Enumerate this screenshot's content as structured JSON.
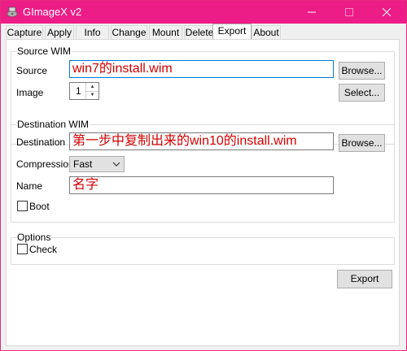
{
  "window": {
    "title": "GImageX v2"
  },
  "tabs": [
    {
      "label": "Capture"
    },
    {
      "label": "Apply"
    },
    {
      "label": "Info"
    },
    {
      "label": "Change"
    },
    {
      "label": "Mount"
    },
    {
      "label": "Delete"
    },
    {
      "label": "Export",
      "active": true
    },
    {
      "label": "About"
    }
  ],
  "source_wim": {
    "group_label": "Source WIM",
    "source_label": "Source",
    "source_value": "win7的install.wim",
    "browse_label": "Browse...",
    "image_label": "Image",
    "image_value": "1",
    "select_label": "Select..."
  },
  "destination_wim": {
    "group_label": "Destination WIM",
    "destination_label": "Destination",
    "destination_value": "第一步中复制出来的win10的install.wim",
    "browse_label": "Browse...",
    "compression_label": "Compression",
    "compression_value": "Fast",
    "name_label": "Name",
    "name_value": "名字",
    "boot_label": "Boot"
  },
  "options": {
    "group_label": "Options",
    "check_label": "Check"
  },
  "export_label": "Export",
  "colors": {
    "titlebar": "#ec1d87",
    "annotation_text": "#d40000",
    "focus_border": "#0078d7"
  }
}
